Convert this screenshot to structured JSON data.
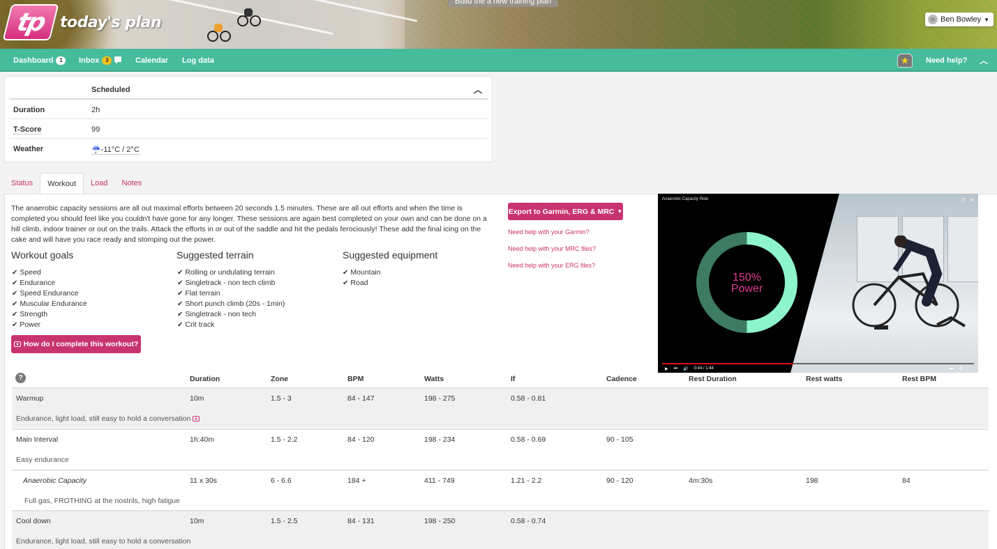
{
  "header": {
    "logo_mark": "tp",
    "logo_text": "today's plan",
    "build_plan_label": "Build the a new training plan",
    "user_name": "Ben Bowley",
    "user_avatar_text": "tp"
  },
  "nav": {
    "items": [
      {
        "label": "Dashboard",
        "badge": "1"
      },
      {
        "label": "Inbox",
        "badge": "3"
      },
      {
        "label": "Calendar"
      },
      {
        "label": "Log data"
      }
    ],
    "need_help": "Need help?",
    "colors": {
      "bar": "#46bc9d",
      "accent": "#c8346f"
    }
  },
  "summary": {
    "column_header": "Scheduled",
    "rows": [
      {
        "label": "Duration",
        "value": "2h"
      },
      {
        "label": "T-Score",
        "value": "99"
      },
      {
        "label": "Weather",
        "value": "-11°C / 2°C",
        "icon": "rain-cloud-icon"
      }
    ]
  },
  "tabs": [
    {
      "label": "Status",
      "active": false
    },
    {
      "label": "Workout",
      "active": true
    },
    {
      "label": "Load",
      "active": false
    },
    {
      "label": "Notes",
      "active": false
    }
  ],
  "workout": {
    "description": "The anaerobic capacity sessions are all out maximal efforts between 20 seconds 1.5 minutes. These are all out efforts and when the time is completed you should feel like you couldn't have gone for any longer. These sessions are again best completed on your own and can be done on a hill climb, indoor trainer or out on the trails. Attack the efforts in or out of the saddle and hit the pedals ferociously! These add the final icing on the cake and will have you race ready and stomping out the power.",
    "goals": {
      "title": "Workout goals",
      "items": [
        "Speed",
        "Endurance",
        "Speed Endurance",
        "Muscular Endurance",
        "Strength",
        "Power"
      ]
    },
    "terrain": {
      "title": "Suggested terrain",
      "items": [
        "Rolling or undulating terrain",
        "Singletrack - non tech climb",
        "Flat terrain",
        "Short punch climb (20s - 1min)",
        "Singletrack - non tech",
        "Crit track"
      ]
    },
    "equipment": {
      "title": "Suggested equipment",
      "items": [
        "Mountain",
        "Road"
      ]
    },
    "how_button": "How do I complete this workout?",
    "export_button": "Export to Garmin, ERG & MRC",
    "help_links": [
      "Need help with your Garmin?",
      "Need help with your MRC files?",
      "Need help with your ERG files?"
    ]
  },
  "video": {
    "title": "Anaerobic Capacity Ride",
    "overlay_line1": "150%",
    "overlay_line2": "Power",
    "time": "0:44 / 1:44",
    "progress_fraction": 0.42
  },
  "intervals": {
    "columns": [
      "Duration",
      "Zone",
      "BPM",
      "Watts",
      "If",
      "Cadence",
      "Rest Duration",
      "Rest watts",
      "Rest BPM"
    ],
    "rows": [
      {
        "name": "Warmup",
        "duration": "10m",
        "zone": "1.5 - 3",
        "bpm": "84 - 147",
        "watts": "198 - 275",
        "if": "0.58 - 0.81",
        "cadence": "",
        "rest_duration": "",
        "rest_watts": "",
        "rest_bpm": "",
        "note": "Endurance, light load, still easy to hold a conversation"
      },
      {
        "name": "Main Interval",
        "duration": "1h:40m",
        "zone": "1.5 - 2.2",
        "bpm": "84 - 120",
        "watts": "198 - 234",
        "if": "0.58 - 0.69",
        "cadence": "90 - 105",
        "rest_duration": "",
        "rest_watts": "",
        "rest_bpm": "",
        "note": "Easy endurance"
      },
      {
        "name": "Anaerobic Capacity",
        "duration": "11 x 30s",
        "zone": "6 - 6.6",
        "bpm": "184 +",
        "watts": "411 - 749",
        "if": "1.21 - 2.2",
        "cadence": "90 - 120",
        "rest_duration": "4m:30s",
        "rest_watts": "198",
        "rest_bpm": "84",
        "note": "Full gas, FROTHING at the nostrils, high fatigue"
      },
      {
        "name": "Cool down",
        "duration": "10m",
        "zone": "1.5 - 2.5",
        "bpm": "84 - 131",
        "watts": "198 - 250",
        "if": "0.58 - 0.74",
        "cadence": "",
        "rest_duration": "",
        "rest_watts": "",
        "rest_bpm": "",
        "note": "Endurance, light load, still easy to hold a conversation"
      }
    ]
  }
}
